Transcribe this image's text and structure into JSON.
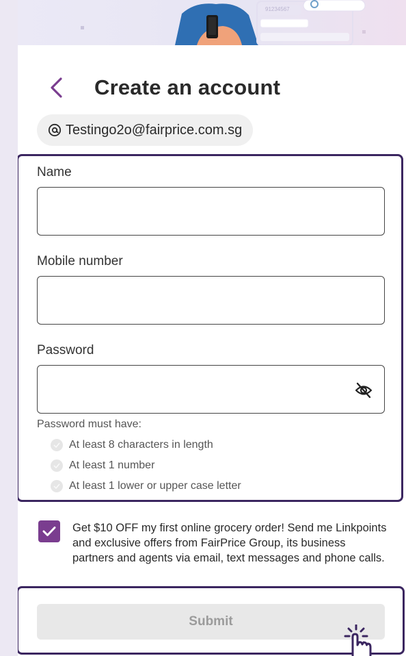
{
  "hero": {
    "phone_number_text": "91234567"
  },
  "header": {
    "title": "Create an account"
  },
  "account": {
    "email": "Testingo2o@fairprice.com.sg"
  },
  "form": {
    "name_label": "Name",
    "name_value": "",
    "mobile_label": "Mobile number",
    "mobile_value": "",
    "password_label": "Password",
    "password_value": "",
    "password_rules_title": "Password must have:",
    "password_rules": [
      "At least 8 characters in length",
      "At least 1 number",
      "At least 1 lower or upper case letter"
    ]
  },
  "consent": {
    "checked": true,
    "text": "Get $10 OFF my first online grocery order! Send me Linkpoints and exclusive offers from FairPrice Group, its business partners and agents via email, text messages and phone calls."
  },
  "submit": {
    "label": "Submit",
    "enabled": false
  },
  "colors": {
    "accent": "#7a3d8f",
    "highlight_border": "#3b2660",
    "disabled_button": "#e8e8e8"
  },
  "icons": {
    "back": "chevron-left-icon",
    "email": "at-sign-icon",
    "password_visibility": "eye-off-icon",
    "rule": "check-circle-icon",
    "cursor": "hand-pointer-icon"
  }
}
